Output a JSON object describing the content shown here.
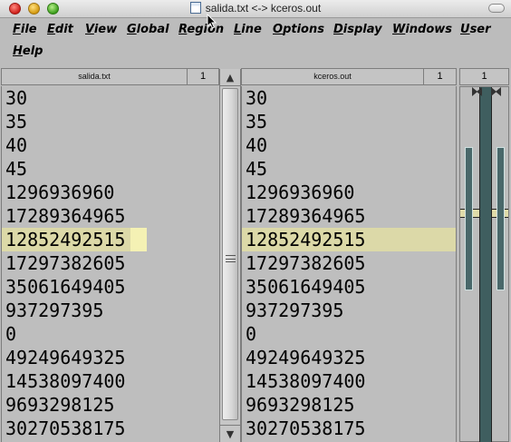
{
  "window": {
    "title": "salida.txt <-> kceros.out"
  },
  "menu": [
    {
      "label": "File",
      "accel": "F"
    },
    {
      "label": "Edit",
      "accel": "E"
    },
    {
      "label": "View",
      "accel": "V"
    },
    {
      "label": "Global",
      "accel": "G"
    },
    {
      "label": "Region",
      "accel": "R"
    },
    {
      "label": "Line",
      "accel": "L"
    },
    {
      "label": "Options",
      "accel": "O"
    },
    {
      "label": "Display",
      "accel": "D"
    },
    {
      "label": "Windows",
      "accel": "W"
    },
    {
      "label": "User",
      "accel": "U"
    },
    {
      "label": "Help",
      "accel": "H"
    }
  ],
  "left_pane": {
    "filename": "salida.txt",
    "line_no": "1",
    "lines": [
      "30",
      "35",
      "40",
      "45",
      "1296936960",
      "17289364965",
      "12852492515",
      "17297382605",
      "35061649405",
      "937297395",
      "0",
      "49249649325",
      "14538097400",
      "9693298125",
      "30270538175"
    ]
  },
  "right_pane": {
    "filename": "kceros.out",
    "line_no": "1",
    "lines": [
      "30",
      "35",
      "40",
      "45",
      "1296936960",
      "17289364965",
      "12852492515",
      "17297382605",
      "35061649405",
      "937297395",
      "0",
      "49249649325",
      "14538097400",
      "9693298125",
      "30270538175"
    ]
  },
  "highlight_line_index": 6,
  "diff_map": {
    "line_no": "1"
  },
  "scrollbar": {
    "up_glyph": "▲",
    "down_glyph": "▼"
  },
  "colors": {
    "highlight": "#dcd9a8",
    "map_center": "#3f5e5f"
  }
}
